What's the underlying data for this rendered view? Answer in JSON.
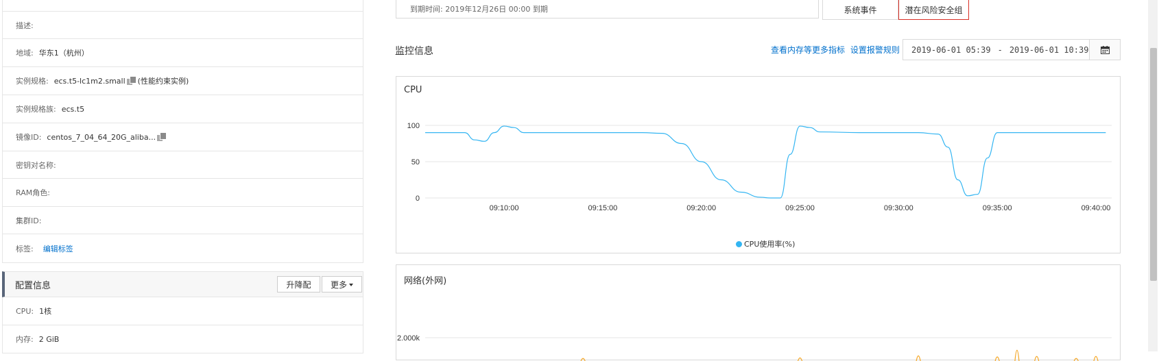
{
  "left_panel": {
    "rows": [
      {
        "label": "描述:",
        "value": ""
      },
      {
        "label": "地域:",
        "value": "华东1（杭州）"
      },
      {
        "label": "实例规格:",
        "value": "ecs.t5-lc1m2.small",
        "suffix": "(性能约束实例)"
      },
      {
        "label": "实例规格族:",
        "value": "ecs.t5"
      },
      {
        "label": "镜像ID:",
        "value": "centos_7_04_64_20G_aliba..."
      },
      {
        "label": "密钥对名称:",
        "value": ""
      },
      {
        "label": "RAM角色:",
        "value": ""
      },
      {
        "label": "集群ID:",
        "value": ""
      },
      {
        "label": "标签:",
        "link": "编辑标签"
      }
    ],
    "config_section": {
      "title": "配置信息",
      "upgrade_label": "升降配",
      "more_label": "更多"
    },
    "config_rows": [
      {
        "label": "CPU:",
        "value": "1核"
      },
      {
        "label": "内存:",
        "value": "2 GiB"
      }
    ]
  },
  "top": {
    "expire_text": "到期时间:  2019年12月26日 00:00 到期",
    "system_events_label": "系统事件",
    "risk_sg_label": "潜在风险安全组"
  },
  "monitor": {
    "title": "监控信息",
    "more_metrics_link": "查看内存等更多指标",
    "alert_rule_link": "设置报警规则",
    "date_start": "2019-06-01 05:39",
    "date_sep": "-",
    "date_end": "2019-06-01 10:39"
  },
  "colors": {
    "cpu_line": "#33b5f2",
    "net_line": "#f5a623",
    "link": "#0070cc",
    "danger": "#d93026"
  },
  "chart_data": [
    {
      "type": "line",
      "title": "CPU",
      "ylim": [
        0,
        100
      ],
      "yticks": [
        0,
        50,
        100
      ],
      "xticks": [
        "09:10:00",
        "09:15:00",
        "09:20:00",
        "09:25:00",
        "09:30:00",
        "09:35:00",
        "09:40:00"
      ],
      "series": [
        {
          "name": "CPU使用率(%)",
          "x": [
            6.0,
            7.0,
            8.0,
            8.5,
            9.0,
            9.5,
            10.0,
            10.5,
            11.0,
            12.0,
            14.0,
            16.0,
            17.0,
            18.0,
            19.0,
            20.0,
            21.0,
            22.0,
            23.0,
            23.5,
            24.0,
            24.5,
            25.0,
            25.5,
            26.0,
            28.0,
            30.0,
            31.0,
            32.0,
            32.5,
            33.0,
            33.5,
            34.0,
            34.5,
            35.0,
            37.0,
            39.0,
            40.5
          ],
          "values": [
            90,
            90,
            90,
            80,
            78,
            90,
            99,
            97,
            90,
            90,
            90,
            90,
            90,
            89,
            75,
            50,
            25,
            8,
            1,
            0,
            0,
            60,
            99,
            97,
            91,
            90,
            90,
            90,
            88,
            70,
            25,
            3,
            5,
            55,
            90,
            90,
            90,
            90
          ]
        }
      ]
    },
    {
      "type": "line",
      "title": "网络(外网)",
      "yticks": [
        "2.000k"
      ],
      "series": [
        {
          "name": "",
          "x": [
            6,
            12,
            14,
            17,
            22,
            24,
            25,
            26,
            27,
            31,
            33,
            34,
            35,
            36,
            37,
            38,
            39,
            40
          ],
          "values": [
            0,
            0,
            0.1,
            0,
            0,
            0,
            0.2,
            0,
            0,
            0.6,
            0,
            0,
            0.4,
            1.7,
            0.5,
            0,
            0.1,
            0.5
          ]
        }
      ]
    }
  ]
}
